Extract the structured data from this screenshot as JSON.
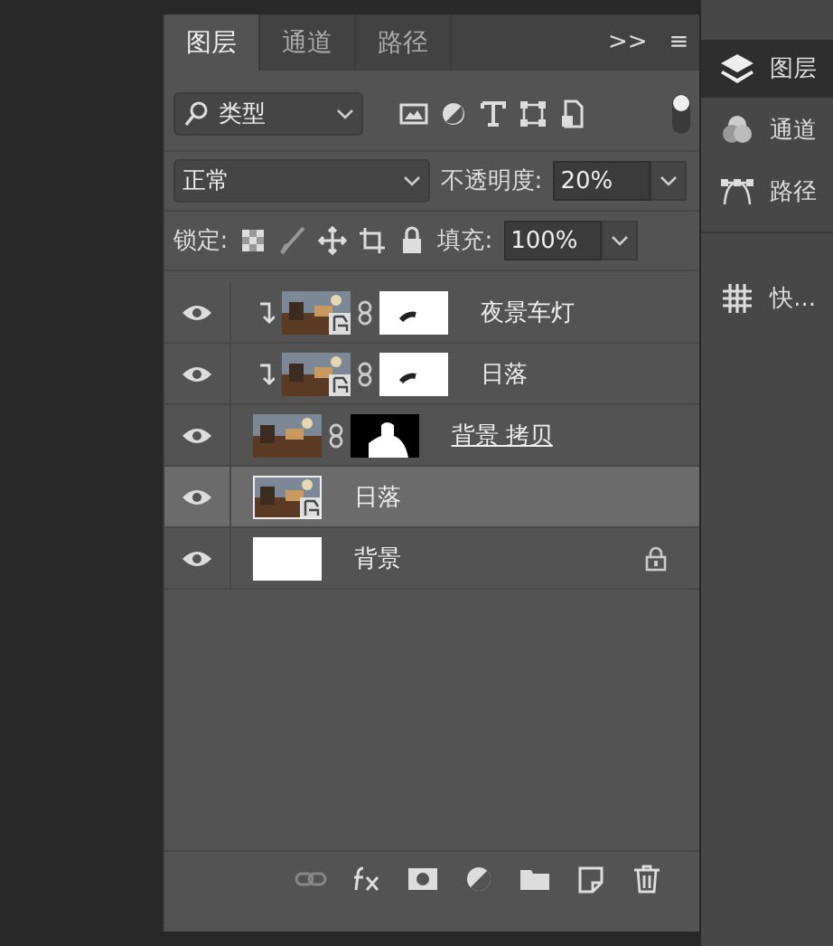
{
  "tabs": [
    {
      "label": "图层",
      "selected": true
    },
    {
      "label": "通道",
      "selected": false
    },
    {
      "label": "路径",
      "selected": false
    }
  ],
  "panel_menu": {
    "expand": ">>",
    "menu": "≡"
  },
  "filter": {
    "value": "类型",
    "filter_on": true
  },
  "blend": {
    "mode": "正常",
    "opacity_label": "不透明度:",
    "opacity": "20%"
  },
  "lock": {
    "label": "锁定:",
    "fill_label": "填充:",
    "fill": "100%"
  },
  "layers": [
    {
      "name": "夜景车灯",
      "visible": true,
      "clipped": true,
      "smart": true,
      "mask": true,
      "locked": false,
      "selected": false,
      "editing": false
    },
    {
      "name": "日落",
      "visible": true,
      "clipped": true,
      "smart": true,
      "mask": true,
      "locked": false,
      "selected": false,
      "editing": false
    },
    {
      "name": "背景 拷贝",
      "visible": true,
      "clipped": false,
      "smart": false,
      "mask": true,
      "locked": false,
      "selected": false,
      "editing": true
    },
    {
      "name": "日落",
      "visible": true,
      "clipped": false,
      "smart": true,
      "mask": false,
      "locked": false,
      "selected": true,
      "editing": false
    },
    {
      "name": "背景",
      "visible": true,
      "clipped": false,
      "smart": false,
      "mask": false,
      "locked": true,
      "selected": false,
      "editing": false,
      "kind": "blank"
    }
  ],
  "dock": [
    {
      "label": "图层",
      "selected": true
    },
    {
      "label": "通道",
      "selected": false
    },
    {
      "label": "路径",
      "selected": false
    },
    {
      "label": "快...",
      "selected": false
    }
  ]
}
